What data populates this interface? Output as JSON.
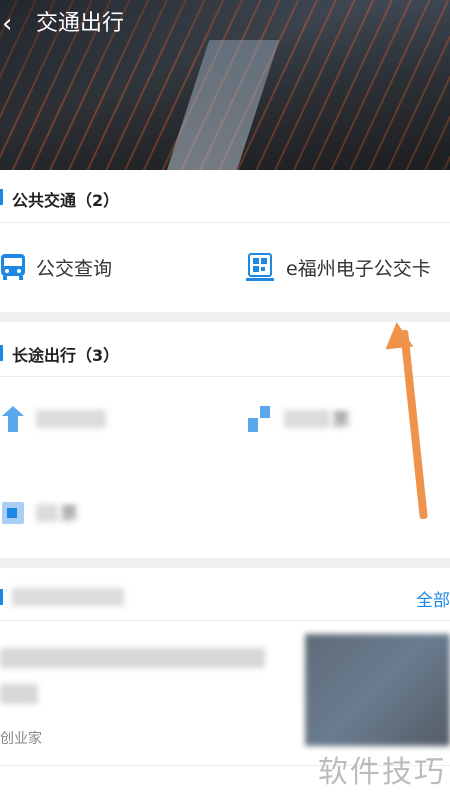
{
  "header": {
    "title": "交通出行"
  },
  "public_transport": {
    "title": "公共交通（2）",
    "items": [
      {
        "label": "公交查询",
        "icon": "bus-icon"
      },
      {
        "label": "e福州电子公交卡",
        "icon": "qr-card-icon"
      }
    ]
  },
  "long_distance": {
    "title": "长途出行（3）",
    "items": [
      {
        "label": "",
        "icon": "plane-icon"
      },
      {
        "label": "",
        "icon": "train-icon"
      },
      {
        "label": "",
        "icon": "ticket-icon"
      }
    ],
    "visible_text": [
      "票",
      "票"
    ]
  },
  "news_section": {
    "more_label": "全部"
  },
  "news": {
    "source": "创业家"
  },
  "watermark": "软件技巧",
  "colors": {
    "accent": "#1e88e5",
    "arrow": "#f0934a"
  }
}
